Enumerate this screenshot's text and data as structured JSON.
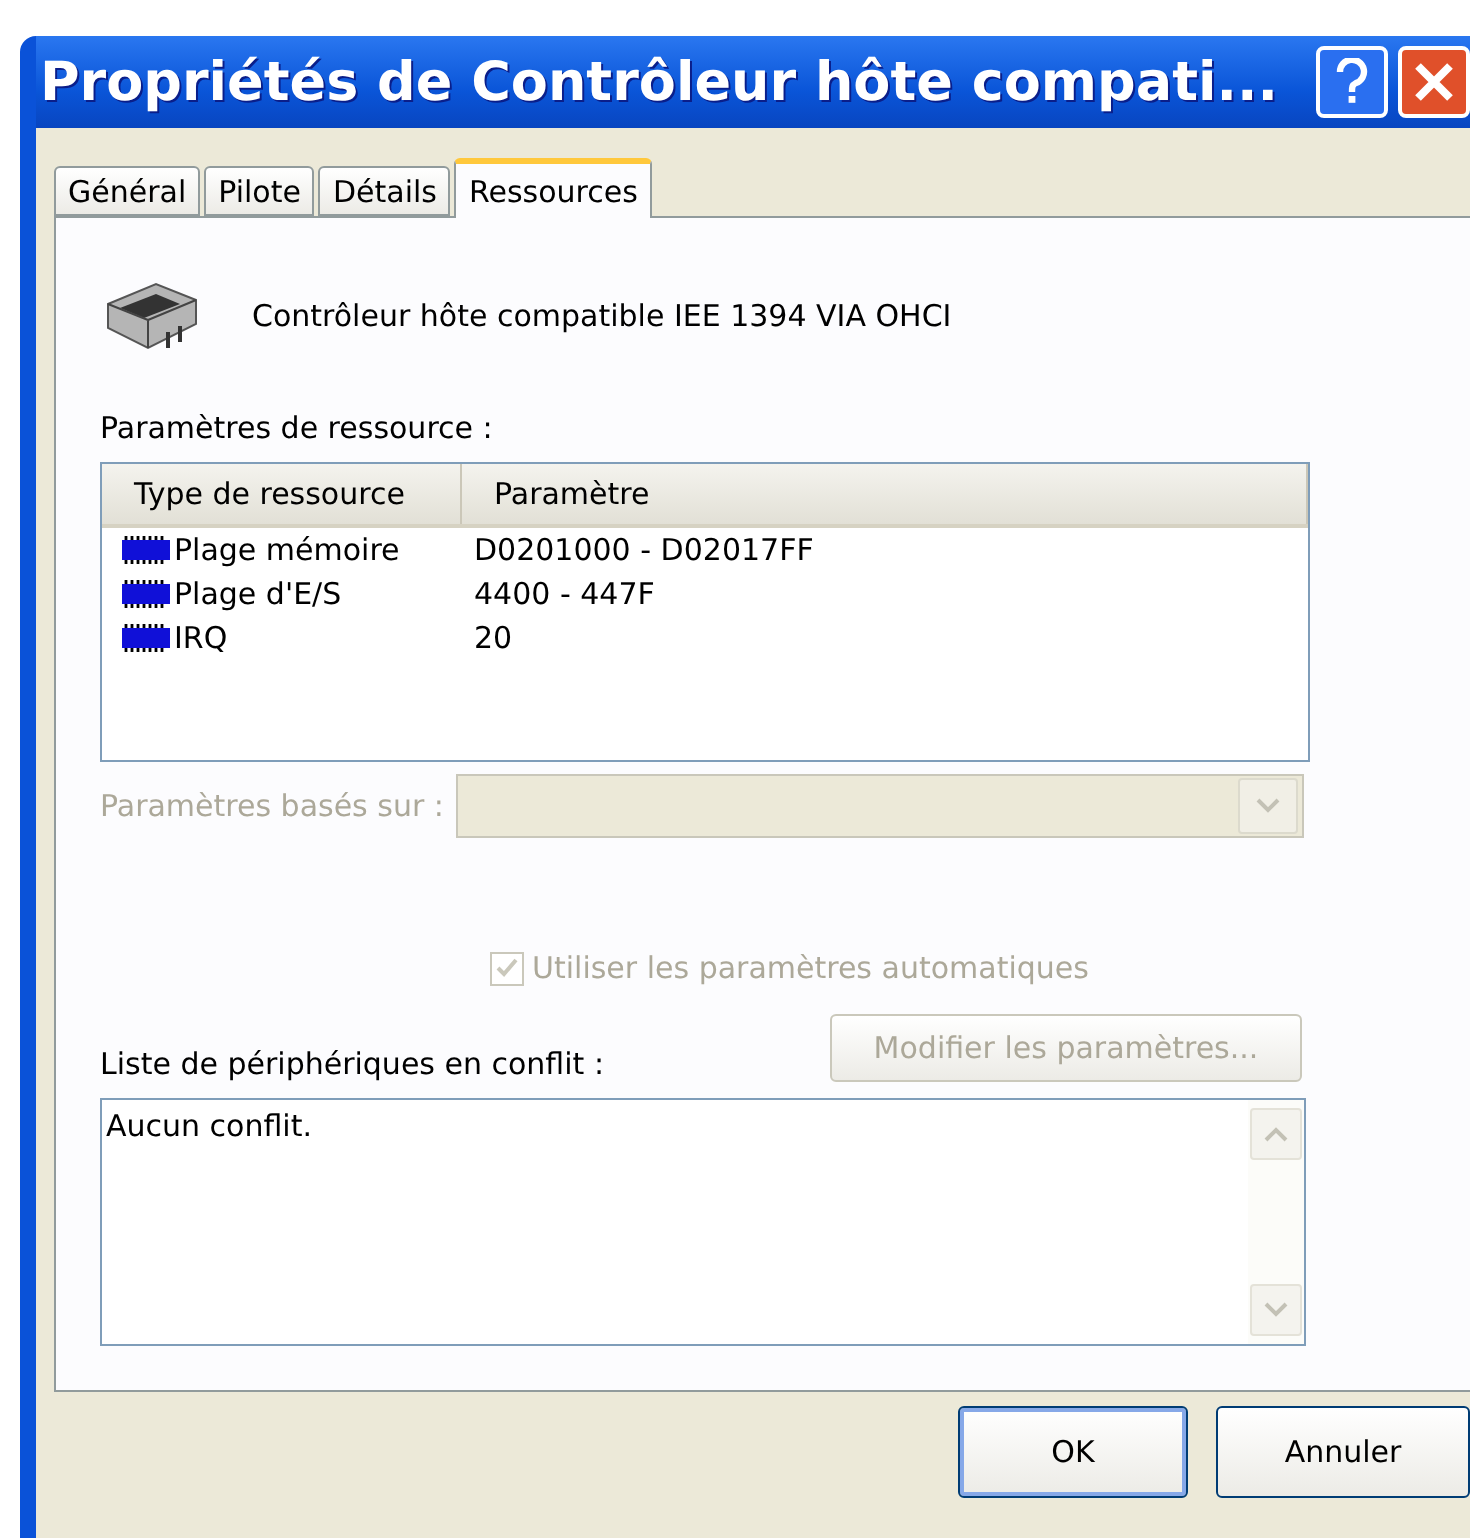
{
  "window": {
    "title": "Propriétés de Contrôleur hôte compati..."
  },
  "tabs": [
    {
      "label": "Général",
      "selected": false
    },
    {
      "label": "Pilote",
      "selected": false
    },
    {
      "label": "Détails",
      "selected": false
    },
    {
      "label": "Ressources",
      "selected": true
    }
  ],
  "device": {
    "name": "Contrôleur hôte compatible IEE 1394 VIA OHCI"
  },
  "resources": {
    "label": "Paramètres de ressource :",
    "columns": [
      "Type de ressource",
      "Paramètre"
    ],
    "rows": [
      {
        "type": "Plage mémoire",
        "setting": "D0201000 - D02017FF"
      },
      {
        "type": "Plage d'E/S",
        "setting": "4400 - 447F"
      },
      {
        "type": "IRQ",
        "setting": "20"
      }
    ]
  },
  "based_on": {
    "label": "Paramètres basés sur :",
    "disabled": true
  },
  "auto_settings": {
    "label": "Utiliser les paramètres automatiques",
    "checked": true,
    "disabled": true
  },
  "conflicts": {
    "label": "Liste de périphériques en conflit :",
    "text": "Aucun conflit."
  },
  "change_button": {
    "label": "Modifier les paramètres...",
    "disabled": true
  },
  "buttons": [
    {
      "label": "OK",
      "kind": "default"
    },
    {
      "label": "Annuler",
      "kind": "normal"
    }
  ]
}
